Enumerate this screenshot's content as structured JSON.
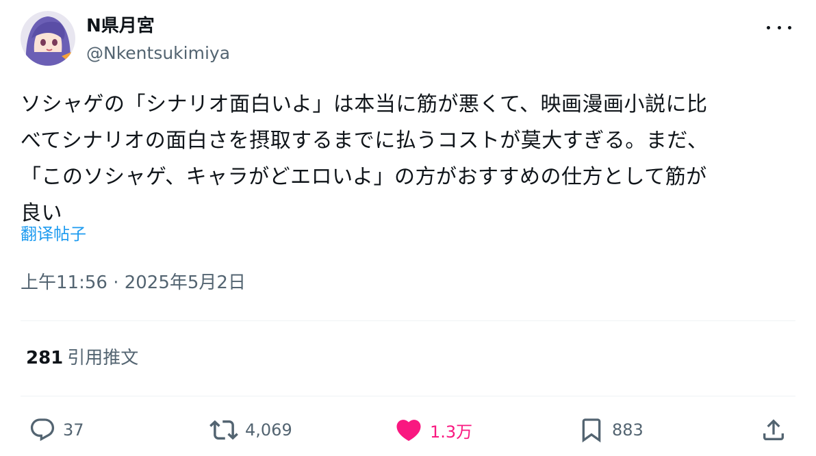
{
  "author": {
    "display_name": "N県月宮",
    "handle": "@Nkentsukimiya"
  },
  "tweet": {
    "lines": [
      "ソシャゲの「シナリオ面白いよ」は本当に筋が悪くて、映画漫画小説に比",
      "べてシナリオの面白さを摂取するまでに払うコストが莫大すぎる。まだ、",
      "「このソシャゲ、キャラがどエロいよ」の方がおすすめの仕方として筋が",
      "良い"
    ],
    "translate_label": "翻译帖子",
    "timestamp": "上午11:56 · 2025年5月2日"
  },
  "stats": {
    "quote_count": "281",
    "quote_label": "引用推文"
  },
  "actions": {
    "replies": "37",
    "reposts": "4,069",
    "likes": "1.3万",
    "bookmarks": "883"
  },
  "icons": [
    "avatar",
    "more-icon",
    "reply-icon",
    "repost-icon",
    "like-icon",
    "bookmark-icon",
    "share-icon"
  ],
  "colors": {
    "text": "#0f1419",
    "secondary": "#536471",
    "link": "#1d9bf0",
    "like": "#f91880",
    "divider": "#eff3f4"
  }
}
